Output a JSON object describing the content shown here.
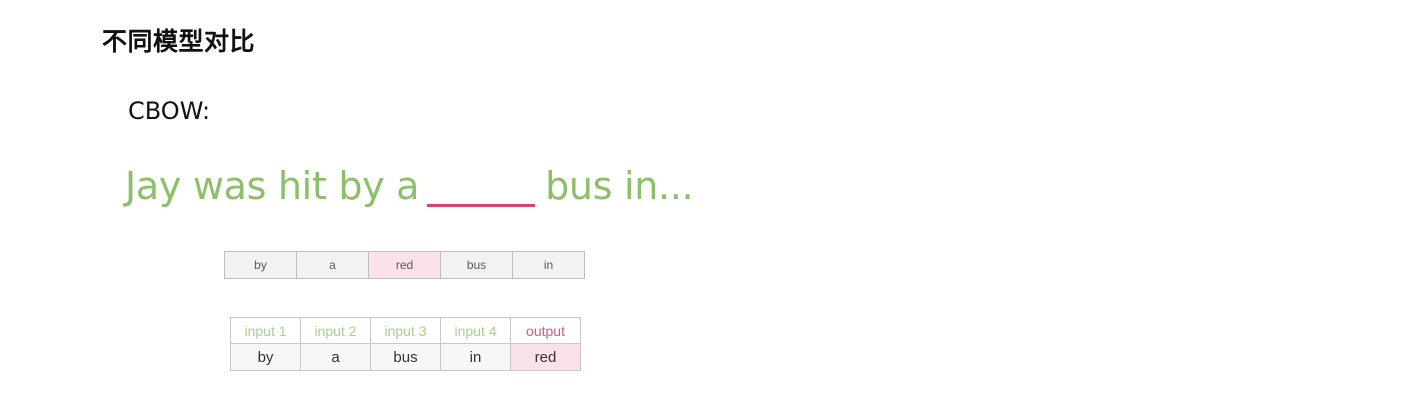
{
  "slide": {
    "title": "不同模型对比",
    "section_label": "CBOW:",
    "sentence": {
      "before_blank": "Jay was hit by a",
      "after_blank": "bus in..."
    }
  },
  "word_row": {
    "words": [
      "by",
      "a",
      "red",
      "bus",
      "in"
    ],
    "highlighted_word": "red"
  },
  "io_table": {
    "headers": [
      "input 1",
      "input 2",
      "input 3",
      "input 4",
      "output"
    ],
    "values": [
      "by",
      "a",
      "bus",
      "in",
      "red"
    ]
  },
  "colors": {
    "sentence_green": "#8dbf6a",
    "header_green": "#a8cf8c",
    "output_pink": "#cf5a8c",
    "highlight_pink_bg": "#fbe2ea",
    "blank_underline": "#d5427a"
  }
}
